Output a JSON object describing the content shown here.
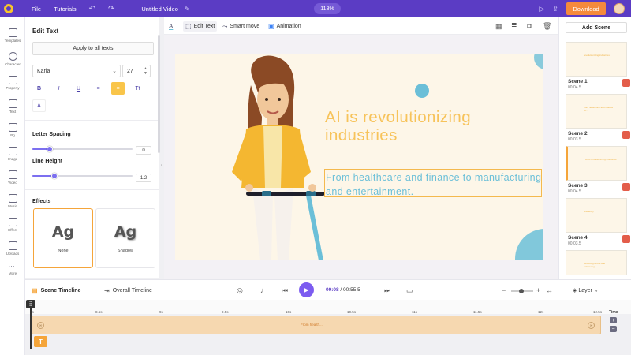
{
  "topbar": {
    "menu": [
      "File",
      "Tutorials"
    ],
    "project_title": "Untitled Video",
    "zoom": "118%",
    "download_label": "Download"
  },
  "rail": [
    {
      "label": "Templates",
      "icon": "templates-icon"
    },
    {
      "label": "Character",
      "icon": "character-icon"
    },
    {
      "label": "Property",
      "icon": "property-icon"
    },
    {
      "label": "Text",
      "icon": "text-icon"
    },
    {
      "label": "Bg",
      "icon": "background-icon"
    },
    {
      "label": "Image",
      "icon": "image-icon"
    },
    {
      "label": "Video",
      "icon": "video-icon"
    },
    {
      "label": "Music",
      "icon": "music-icon"
    },
    {
      "label": "Effect",
      "icon": "effect-icon"
    },
    {
      "label": "Uploads",
      "icon": "uploads-icon"
    },
    {
      "label": "More",
      "icon": "more-icon"
    }
  ],
  "panel": {
    "title": "Edit Text",
    "apply_all": "Apply to all texts",
    "font": "Karla",
    "font_size": "27",
    "format_buttons": [
      "B",
      "I",
      "U",
      "≡",
      "≡",
      "Tt"
    ],
    "color_button": "A",
    "letter_spacing": {
      "label": "Letter Spacing",
      "value": "0",
      "fraction": 0.17
    },
    "line_height": {
      "label": "Line Height",
      "value": "1.2",
      "fraction": 0.22
    },
    "effects": {
      "label": "Effects",
      "options": [
        {
          "sample": "Ag",
          "name": "None"
        },
        {
          "sample": "Ag",
          "name": "Shadow"
        }
      ]
    }
  },
  "canvas_toolbar": {
    "tools": [
      "Edit Text",
      "Smart move",
      "Animation"
    ]
  },
  "canvas": {
    "headline": "AI is revolutionizing industries",
    "subline": "From healthcare and finance to manufacturing and entertainment.",
    "colors": {
      "headline": "#f7c35a",
      "subline": "#6bbfd8",
      "background": "#fdf6e8"
    }
  },
  "scenes": {
    "add_label": "Add Scene",
    "items": [
      {
        "name": "Scene 1",
        "duration": "00:04.5",
        "mini": "revolutionizing industries"
      },
      {
        "name": "Scene 2",
        "duration": "00:03.5",
        "mini": "from healthcare and finance to..."
      },
      {
        "name": "Scene 3",
        "duration": "00:04.5",
        "mini": "AI is revolutionizing industries"
      },
      {
        "name": "Scene 4",
        "duration": "00:03.5",
        "mini": "Efficiency"
      },
      {
        "name": "Scene 5",
        "duration": "",
        "mini": "Reducing errors and enhancing"
      }
    ]
  },
  "timeline": {
    "scene_tab": "Scene Timeline",
    "overall_tab": "Overall Timeline",
    "current_time": "00:08",
    "total_time": "00:55.5",
    "layer_label": "Layer",
    "ticks": [
      "8s",
      "8.5s",
      "9s",
      "9.5s",
      "10s",
      "10.5s",
      "11s",
      "11.5s",
      "12s",
      "12.5s"
    ],
    "track_label": "From health...",
    "time_label": "Time"
  }
}
